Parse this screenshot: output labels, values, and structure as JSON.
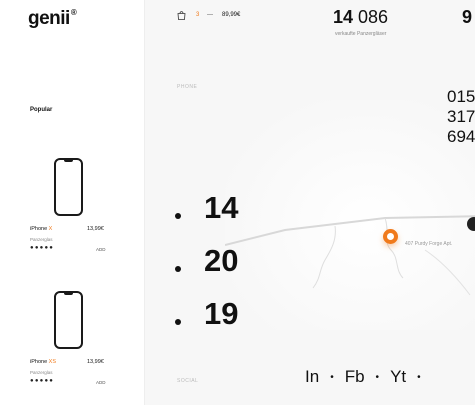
{
  "brand": {
    "logo": "genii",
    "logo_mark": "®"
  },
  "sidebar": {
    "section_title": "Popular",
    "products": [
      {
        "name": "iPhone ",
        "model": "X",
        "price": "13,99€",
        "subtitle": "Panzerglas",
        "dots": "●●●●●",
        "add_label": "ADD"
      },
      {
        "name": "iPhone ",
        "model": "XS",
        "price": "13,99€",
        "subtitle": "Panzerglas",
        "dots": "●●●●●",
        "add_label": "ADD"
      }
    ]
  },
  "cart": {
    "count": "3",
    "separator": "—",
    "total": "89,99€"
  },
  "stats": {
    "sold_bold": "14",
    "sold_rest": " 086",
    "sold_label": "verkaufte Panzergläser",
    "second_partial": "9"
  },
  "contact": {
    "label": "PHONE",
    "lines": [
      "015",
      "317",
      "694"
    ]
  },
  "dates": [
    "14",
    "20",
    "19"
  ],
  "map": {
    "address": "407 Purdy Forge Apt."
  },
  "social": {
    "label": "SOCIAL",
    "links": [
      "In",
      "Fb",
      "Yt"
    ],
    "separator": "•"
  },
  "colors": {
    "accent": "#f07a1c",
    "text": "#111111",
    "muted": "#888888",
    "background": "#f7f7f7"
  }
}
